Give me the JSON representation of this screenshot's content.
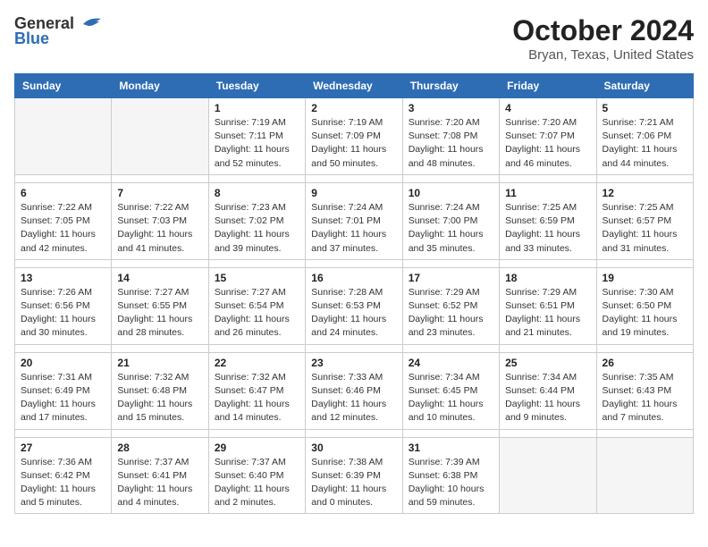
{
  "logo": {
    "line1": "General",
    "line2": "Blue",
    "tagline": ""
  },
  "title": "October 2024",
  "subtitle": "Bryan, Texas, United States",
  "days_of_week": [
    "Sunday",
    "Monday",
    "Tuesday",
    "Wednesday",
    "Thursday",
    "Friday",
    "Saturday"
  ],
  "weeks": [
    [
      {
        "num": "",
        "sunrise": "",
        "sunset": "",
        "daylight": "",
        "empty": true
      },
      {
        "num": "",
        "sunrise": "",
        "sunset": "",
        "daylight": "",
        "empty": true
      },
      {
        "num": "1",
        "sunrise": "Sunrise: 7:19 AM",
        "sunset": "Sunset: 7:11 PM",
        "daylight": "Daylight: 11 hours and 52 minutes."
      },
      {
        "num": "2",
        "sunrise": "Sunrise: 7:19 AM",
        "sunset": "Sunset: 7:09 PM",
        "daylight": "Daylight: 11 hours and 50 minutes."
      },
      {
        "num": "3",
        "sunrise": "Sunrise: 7:20 AM",
        "sunset": "Sunset: 7:08 PM",
        "daylight": "Daylight: 11 hours and 48 minutes."
      },
      {
        "num": "4",
        "sunrise": "Sunrise: 7:20 AM",
        "sunset": "Sunset: 7:07 PM",
        "daylight": "Daylight: 11 hours and 46 minutes."
      },
      {
        "num": "5",
        "sunrise": "Sunrise: 7:21 AM",
        "sunset": "Sunset: 7:06 PM",
        "daylight": "Daylight: 11 hours and 44 minutes."
      }
    ],
    [
      {
        "num": "6",
        "sunrise": "Sunrise: 7:22 AM",
        "sunset": "Sunset: 7:05 PM",
        "daylight": "Daylight: 11 hours and 42 minutes."
      },
      {
        "num": "7",
        "sunrise": "Sunrise: 7:22 AM",
        "sunset": "Sunset: 7:03 PM",
        "daylight": "Daylight: 11 hours and 41 minutes."
      },
      {
        "num": "8",
        "sunrise": "Sunrise: 7:23 AM",
        "sunset": "Sunset: 7:02 PM",
        "daylight": "Daylight: 11 hours and 39 minutes."
      },
      {
        "num": "9",
        "sunrise": "Sunrise: 7:24 AM",
        "sunset": "Sunset: 7:01 PM",
        "daylight": "Daylight: 11 hours and 37 minutes."
      },
      {
        "num": "10",
        "sunrise": "Sunrise: 7:24 AM",
        "sunset": "Sunset: 7:00 PM",
        "daylight": "Daylight: 11 hours and 35 minutes."
      },
      {
        "num": "11",
        "sunrise": "Sunrise: 7:25 AM",
        "sunset": "Sunset: 6:59 PM",
        "daylight": "Daylight: 11 hours and 33 minutes."
      },
      {
        "num": "12",
        "sunrise": "Sunrise: 7:25 AM",
        "sunset": "Sunset: 6:57 PM",
        "daylight": "Daylight: 11 hours and 31 minutes."
      }
    ],
    [
      {
        "num": "13",
        "sunrise": "Sunrise: 7:26 AM",
        "sunset": "Sunset: 6:56 PM",
        "daylight": "Daylight: 11 hours and 30 minutes."
      },
      {
        "num": "14",
        "sunrise": "Sunrise: 7:27 AM",
        "sunset": "Sunset: 6:55 PM",
        "daylight": "Daylight: 11 hours and 28 minutes."
      },
      {
        "num": "15",
        "sunrise": "Sunrise: 7:27 AM",
        "sunset": "Sunset: 6:54 PM",
        "daylight": "Daylight: 11 hours and 26 minutes."
      },
      {
        "num": "16",
        "sunrise": "Sunrise: 7:28 AM",
        "sunset": "Sunset: 6:53 PM",
        "daylight": "Daylight: 11 hours and 24 minutes."
      },
      {
        "num": "17",
        "sunrise": "Sunrise: 7:29 AM",
        "sunset": "Sunset: 6:52 PM",
        "daylight": "Daylight: 11 hours and 23 minutes."
      },
      {
        "num": "18",
        "sunrise": "Sunrise: 7:29 AM",
        "sunset": "Sunset: 6:51 PM",
        "daylight": "Daylight: 11 hours and 21 minutes."
      },
      {
        "num": "19",
        "sunrise": "Sunrise: 7:30 AM",
        "sunset": "Sunset: 6:50 PM",
        "daylight": "Daylight: 11 hours and 19 minutes."
      }
    ],
    [
      {
        "num": "20",
        "sunrise": "Sunrise: 7:31 AM",
        "sunset": "Sunset: 6:49 PM",
        "daylight": "Daylight: 11 hours and 17 minutes."
      },
      {
        "num": "21",
        "sunrise": "Sunrise: 7:32 AM",
        "sunset": "Sunset: 6:48 PM",
        "daylight": "Daylight: 11 hours and 15 minutes."
      },
      {
        "num": "22",
        "sunrise": "Sunrise: 7:32 AM",
        "sunset": "Sunset: 6:47 PM",
        "daylight": "Daylight: 11 hours and 14 minutes."
      },
      {
        "num": "23",
        "sunrise": "Sunrise: 7:33 AM",
        "sunset": "Sunset: 6:46 PM",
        "daylight": "Daylight: 11 hours and 12 minutes."
      },
      {
        "num": "24",
        "sunrise": "Sunrise: 7:34 AM",
        "sunset": "Sunset: 6:45 PM",
        "daylight": "Daylight: 11 hours and 10 minutes."
      },
      {
        "num": "25",
        "sunrise": "Sunrise: 7:34 AM",
        "sunset": "Sunset: 6:44 PM",
        "daylight": "Daylight: 11 hours and 9 minutes."
      },
      {
        "num": "26",
        "sunrise": "Sunrise: 7:35 AM",
        "sunset": "Sunset: 6:43 PM",
        "daylight": "Daylight: 11 hours and 7 minutes."
      }
    ],
    [
      {
        "num": "27",
        "sunrise": "Sunrise: 7:36 AM",
        "sunset": "Sunset: 6:42 PM",
        "daylight": "Daylight: 11 hours and 5 minutes."
      },
      {
        "num": "28",
        "sunrise": "Sunrise: 7:37 AM",
        "sunset": "Sunset: 6:41 PM",
        "daylight": "Daylight: 11 hours and 4 minutes."
      },
      {
        "num": "29",
        "sunrise": "Sunrise: 7:37 AM",
        "sunset": "Sunset: 6:40 PM",
        "daylight": "Daylight: 11 hours and 2 minutes."
      },
      {
        "num": "30",
        "sunrise": "Sunrise: 7:38 AM",
        "sunset": "Sunset: 6:39 PM",
        "daylight": "Daylight: 11 hours and 0 minutes."
      },
      {
        "num": "31",
        "sunrise": "Sunrise: 7:39 AM",
        "sunset": "Sunset: 6:38 PM",
        "daylight": "Daylight: 10 hours and 59 minutes."
      },
      {
        "num": "",
        "sunrise": "",
        "sunset": "",
        "daylight": "",
        "empty": true
      },
      {
        "num": "",
        "sunrise": "",
        "sunset": "",
        "daylight": "",
        "empty": true
      }
    ]
  ]
}
